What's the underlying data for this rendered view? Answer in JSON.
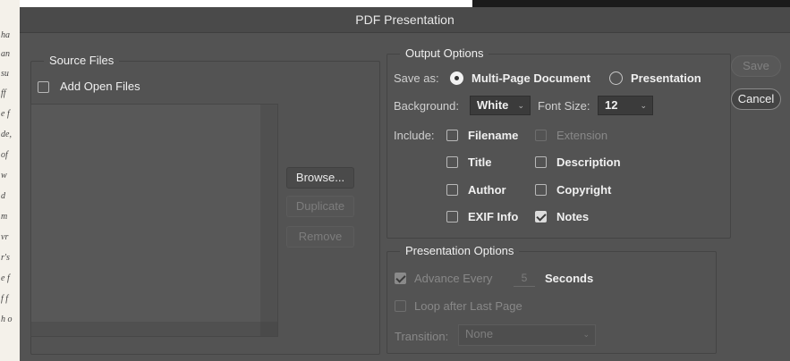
{
  "dialog": {
    "title": "PDF Presentation",
    "save_label": "Save",
    "cancel_label": "Cancel"
  },
  "source_files": {
    "legend": "Source Files",
    "add_open_files_label": "Add Open Files",
    "add_open_files_checked": false,
    "browse_label": "Browse...",
    "duplicate_label": "Duplicate",
    "remove_label": "Remove"
  },
  "output_options": {
    "legend": "Output Options",
    "save_as_label": "Save as:",
    "save_as_options": [
      "Multi-Page Document",
      "Presentation"
    ],
    "save_as_selected": "Multi-Page Document",
    "background_label": "Background:",
    "background_value": "White",
    "font_size_label": "Font Size:",
    "font_size_value": "12",
    "include_label": "Include:",
    "include": {
      "filename": {
        "label": "Filename",
        "checked": false,
        "enabled": true
      },
      "extension": {
        "label": "Extension",
        "checked": false,
        "enabled": false
      },
      "title": {
        "label": "Title",
        "checked": false,
        "enabled": true
      },
      "description": {
        "label": "Description",
        "checked": false,
        "enabled": true
      },
      "author": {
        "label": "Author",
        "checked": false,
        "enabled": true
      },
      "copyright": {
        "label": "Copyright",
        "checked": false,
        "enabled": true
      },
      "exif_info": {
        "label": "EXIF Info",
        "checked": false,
        "enabled": true
      },
      "notes": {
        "label": "Notes",
        "checked": true,
        "enabled": true
      }
    }
  },
  "presentation_options": {
    "legend": "Presentation Options",
    "advance_every_label": "Advance Every",
    "advance_every_value": "5",
    "seconds_label": "Seconds",
    "loop_label": "Loop after Last Page",
    "transition_label": "Transition:",
    "transition_value": "None"
  },
  "background_document": {
    "top_text": "",
    "fragments": [
      "ha",
      "an",
      "su",
      "ff",
      "e f",
      "de,",
      "of",
      "w",
      "d",
      "m",
      "vr",
      "r's",
      "e f",
      "f f",
      "h o"
    ]
  },
  "colors": {
    "dialog_bg": "#535353",
    "titlebar_bg": "#4a4a4a",
    "text": "#f0f0f0",
    "disabled_text": "#808080"
  },
  "icons": {
    "dropdown": "chevron-down-icon",
    "check": "checkmark-icon",
    "radio": "radio-dot-icon"
  }
}
